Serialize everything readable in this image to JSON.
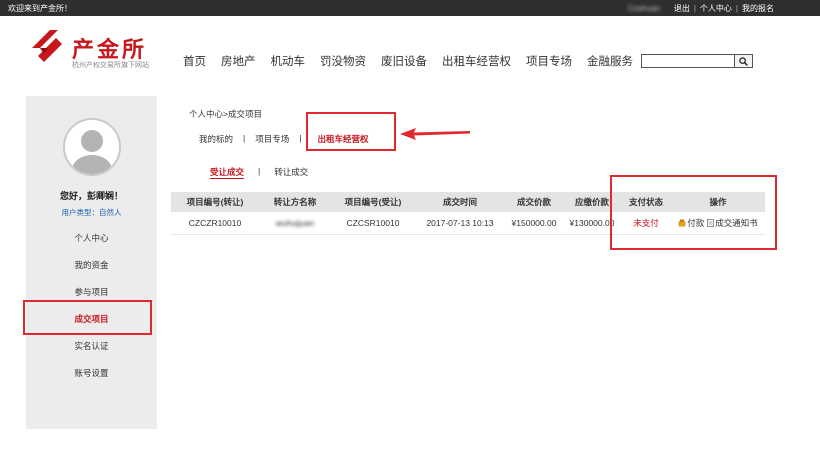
{
  "topbar": {
    "welcome": "欢迎来到产金所！",
    "username": "Coshuan",
    "logout": "退出",
    "personal_center": "个人中心",
    "my_registration": "我的报名",
    "separator": "|"
  },
  "logo": {
    "name": "产金所",
    "subtitle": "杭州产权交易所旗下网站"
  },
  "nav": [
    "首页",
    "房地产",
    "机动车",
    "罚没物资",
    "废旧设备",
    "出租车经营权",
    "项目专场",
    "金融服务"
  ],
  "search": {
    "value": "",
    "placeholder": ""
  },
  "sidebar": {
    "greeting": "您好，彭卿娴！",
    "user_type": "用户类型：自然人",
    "items": [
      {
        "label": "个人中心",
        "active": false
      },
      {
        "label": "我的资金",
        "active": false
      },
      {
        "label": "参与项目",
        "active": false
      },
      {
        "label": "成交项目",
        "active": true
      },
      {
        "label": "实名认证",
        "active": false
      },
      {
        "label": "账号设置",
        "active": false
      }
    ]
  },
  "breadcrumb": "个人中心>成交项目",
  "category_tabs": [
    {
      "label": "我的标的",
      "active": false
    },
    {
      "label": "项目专场",
      "active": false
    },
    {
      "label": "出租车经营权",
      "active": true
    }
  ],
  "tab_separator": "|",
  "sub_tabs": [
    {
      "label": "受让成交",
      "active": true
    },
    {
      "label": "转让成交",
      "active": false
    }
  ],
  "table": {
    "columns": [
      "项目编号(转让)",
      "转让方名称",
      "项目编号(受让)",
      "成交时间",
      "成交价款",
      "应缴价款",
      "支付状态",
      "操作"
    ],
    "rows": [
      {
        "transfer_no": "CZCZR10010",
        "transferor": "wuhuijuan",
        "receive_no": "CZCSR10010",
        "deal_time": "2017-07-13 10:13",
        "deal_price": "¥150000.00",
        "payable": "¥130000.00",
        "pay_status": "未支付",
        "action_pay": "付款",
        "action_notice": "成交通知书"
      }
    ]
  },
  "colors": {
    "brand_red": "#c8161d",
    "topbar_bg": "#2f2f2f",
    "sidebar_bg": "#ececec",
    "annotation_red": "#e0282e",
    "link_blue": "#1a5fb4"
  },
  "icons": [
    "search-icon",
    "avatar-placeholder-icon",
    "pay-icon",
    "document-icon",
    "arrow-annotation-icon"
  ]
}
